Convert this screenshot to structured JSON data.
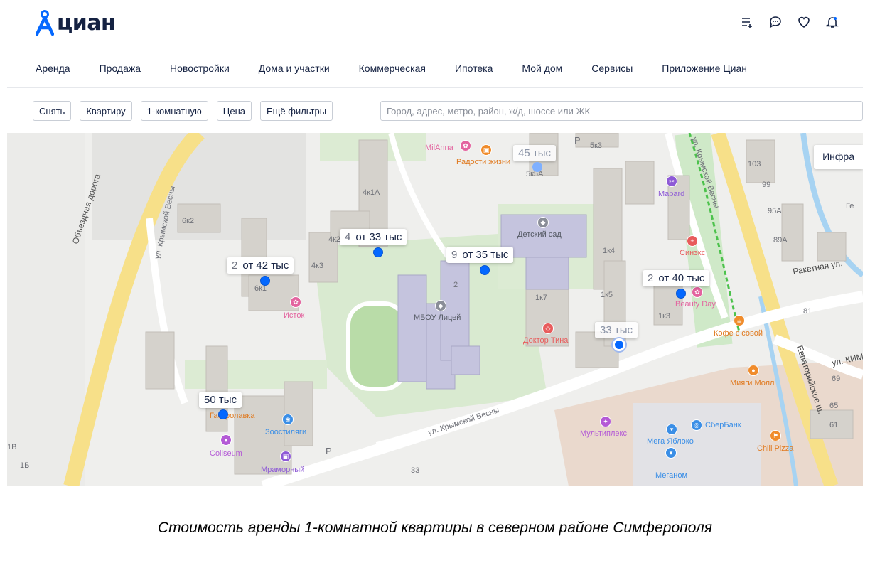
{
  "brand": {
    "name": "циан",
    "accent": "#0468ff"
  },
  "header_icons": [
    "list-add-icon",
    "chat-icon",
    "heart-icon",
    "bell-icon"
  ],
  "nav": [
    "Аренда",
    "Продажа",
    "Новостройки",
    "Дома и участки",
    "Коммерческая",
    "Ипотека",
    "Мой дом",
    "Сервисы",
    "Приложение Циан"
  ],
  "filters": {
    "deal": "Снять",
    "type": "Квартиру",
    "rooms": "1-комнатную",
    "price": "Цена",
    "more": "Ещё фильтры",
    "search_placeholder": "Город, адрес, метро, район, ж/д, шоссе или ЖК"
  },
  "map": {
    "infra_button": "Инфра",
    "price_bubbles": [
      {
        "count": "",
        "price": "45 тыс",
        "faded": true
      },
      {
        "count": "4",
        "price": "от 33 тыс"
      },
      {
        "count": "9",
        "price": "от 35 тыс"
      },
      {
        "count": "2",
        "price": "от 42 тыс"
      },
      {
        "count": "2",
        "price": "от 40 тыс"
      },
      {
        "count": "",
        "price": "33 тыс",
        "faded": true
      },
      {
        "count": "",
        "price": "50 тыс"
      }
    ],
    "pois": [
      {
        "name": "MilAnna",
        "color": "#e3649f"
      },
      {
        "name": "Радости жизни",
        "color": "#f08c2c"
      },
      {
        "name": "Mapard",
        "color": "#8e5ad6"
      },
      {
        "name": "Детский сад",
        "color": "#8a8e98"
      },
      {
        "name": "Синэкс",
        "color": "#e85c5c"
      },
      {
        "name": "Beauty Day",
        "color": "#e3649f"
      },
      {
        "name": "Исток",
        "color": "#e3649f"
      },
      {
        "name": "МБОУ Лицей",
        "color": "#8a8e98"
      },
      {
        "name": "Доктор Тина",
        "color": "#e85c5c"
      },
      {
        "name": "Кофе с совой",
        "color": "#f08c2c"
      },
      {
        "name": "Мияги Молл",
        "color": "#f08c2c"
      },
      {
        "name": "Гастролавка",
        "color": "#f08c2c"
      },
      {
        "name": "Зоостиляги",
        "color": "#3a8ee6"
      },
      {
        "name": "Coliseum",
        "color": "#b45ad6"
      },
      {
        "name": "Мраморный",
        "color": "#8e5ad6"
      },
      {
        "name": "Мультиплекс",
        "color": "#b45ad6"
      },
      {
        "name": "СберБанк",
        "color": "#3a8ee6"
      },
      {
        "name": "Мега Яблоко",
        "color": "#3a8ee6"
      },
      {
        "name": "Меганом",
        "color": "#3a8ee6"
      },
      {
        "name": "Chili Pizza",
        "color": "#f08c2c"
      }
    ],
    "streets": [
      "Объездная дорога",
      "ул. Крымской Весны",
      "ул. Крымской Весны",
      "ул. Крымской Весны",
      "Ракетная ул.",
      "Евпаторийское ш.",
      "ул. КИМ"
    ],
    "house_numbers": [
      "6к2",
      "4к1А",
      "4к2",
      "4к3",
      "6к1",
      "5к3",
      "5к5А",
      "2",
      "1к4",
      "1к5",
      "1к7",
      "1к3",
      "103",
      "99",
      "95А",
      "89А",
      "81",
      "69",
      "65",
      "61",
      "33",
      "1В",
      "1Б",
      "P",
      "P",
      "Ге"
    ]
  },
  "caption": "Стоимость аренды 1-комнатной квартиры в северном районе Симферополя"
}
